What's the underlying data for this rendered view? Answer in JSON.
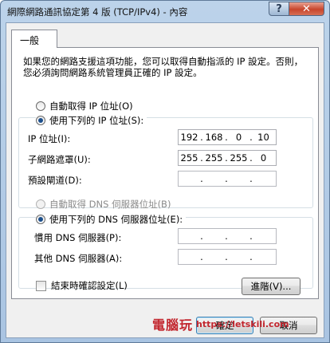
{
  "window": {
    "title": "網際網路通訊協定第 4 版 (TCP/IPv4) - 內容",
    "help_label": "?",
    "close_label": "✕"
  },
  "tabs": [
    {
      "label": "一般"
    }
  ],
  "general": {
    "description": "如果您的網路支援這項功能，您可以取得自動指派的 IP 設定。否則，您必須詢問網路系統管理員正確的 IP 設定。",
    "ip_section": {
      "auto_label": "自動取得 IP 位址(O)",
      "manual_label": "使用下列的 IP 位址(S):",
      "selected": "manual",
      "fields": [
        {
          "label": "IP 位址(I):",
          "octets": [
            "192",
            "168",
            "0",
            "10"
          ]
        },
        {
          "label": "子網路遮罩(U):",
          "octets": [
            "255",
            "255",
            "255",
            "0"
          ]
        },
        {
          "label": "預設閘道(D):",
          "octets": [
            "",
            "",
            "",
            ""
          ]
        }
      ]
    },
    "dns_section": {
      "auto_label": "自動取得 DNS 伺服器位址(B)",
      "manual_label": "使用下列的 DNS 伺服器位址(E):",
      "selected": "manual",
      "fields": [
        {
          "label": "慣用 DNS 伺服器(P):",
          "octets": [
            "",
            "",
            "",
            ""
          ]
        },
        {
          "label": "其他 DNS 伺服器(A):",
          "octets": [
            "",
            "",
            "",
            ""
          ]
        }
      ]
    },
    "validate_label": "結束時確認設定(L)",
    "validate_checked": false,
    "advanced_label": "進階(V)..."
  },
  "footer": {
    "ok_label": "確定",
    "cancel_label": "取消"
  },
  "watermark": {
    "text": "電腦玩",
    "url": "https://letskili.com"
  },
  "colors": {
    "radio_dot": "#1c4f8c",
    "close_button": "#c8452c",
    "watermark": "#c2262e"
  }
}
